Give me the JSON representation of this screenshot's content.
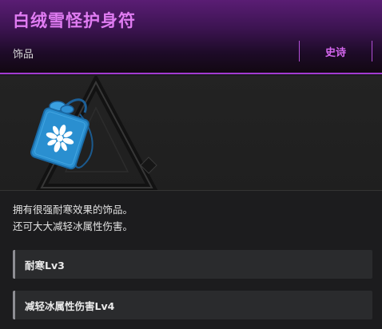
{
  "item": {
    "name": "白绒雪怪护身符",
    "category": "饰品",
    "rarity": "史诗",
    "image_icon": "blue-snowflake-charm-icon",
    "description_lines": [
      "拥有很强耐寒效果的饰品。",
      "还可大大减轻冰属性伤害。"
    ],
    "effects": [
      "耐寒Lv3",
      "减轻冰属性伤害Lv4"
    ]
  },
  "colors": {
    "rarity_accent": "#a23bd1",
    "title_text": "#e07cf2",
    "charm_blue": "#2a8fd0"
  }
}
